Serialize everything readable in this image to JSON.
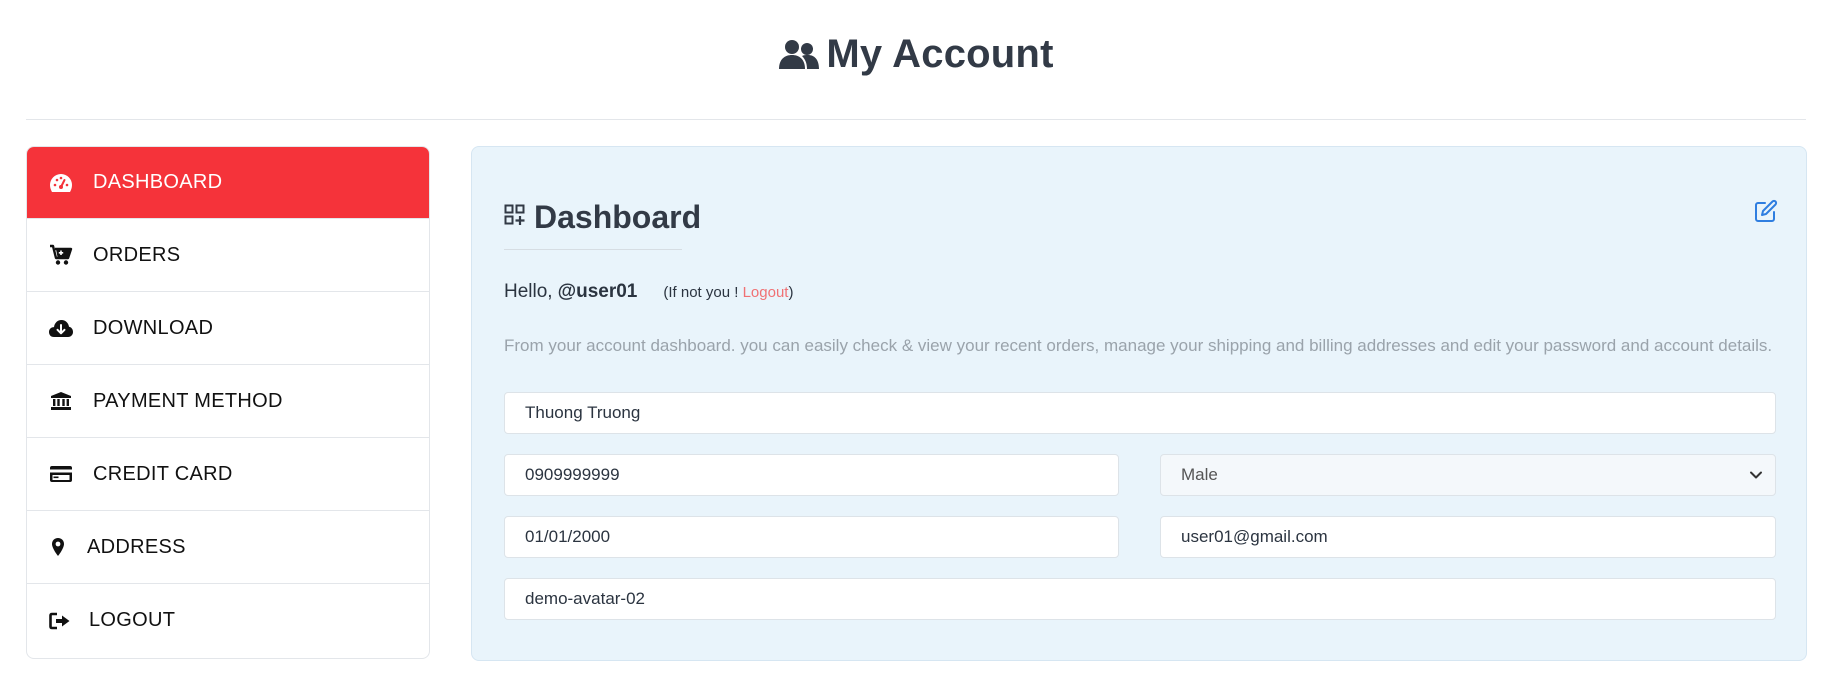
{
  "header": {
    "title": "My Account",
    "icon": "users-icon"
  },
  "sidebar": {
    "items": [
      {
        "label": "DASHBOARD",
        "icon": "tachometer-icon",
        "active": true
      },
      {
        "label": "ORDERS",
        "icon": "cart-icon"
      },
      {
        "label": "DOWNLOAD",
        "icon": "cloud-download-icon"
      },
      {
        "label": "PAYMENT METHOD",
        "icon": "bank-icon"
      },
      {
        "label": "CREDIT CARD",
        "icon": "credit-card-icon"
      },
      {
        "label": "ADDRESS",
        "icon": "map-marker-icon"
      },
      {
        "label": "LOGOUT",
        "icon": "sign-out-icon"
      }
    ]
  },
  "main": {
    "title": "Dashboard",
    "greeting_prefix": "Hello,",
    "username": "@user01",
    "not_you_prefix": "(If not you ! ",
    "logout_link": "Logout",
    "not_you_suffix": ")",
    "description": "From your account dashboard. you can easily check & view your recent orders, manage your shipping and billing addresses and edit your password and account details.",
    "form": {
      "name": "Thuong Truong",
      "phone": "0909999999",
      "gender": "Male",
      "dob": "01/01/2000",
      "email": "user01@gmail.com",
      "avatar": "demo-avatar-02"
    }
  },
  "colors": {
    "active": "#f5333a",
    "panel_bg": "#e9f4fb",
    "link": "#f07174",
    "edit_icon": "#2f7ee0"
  }
}
